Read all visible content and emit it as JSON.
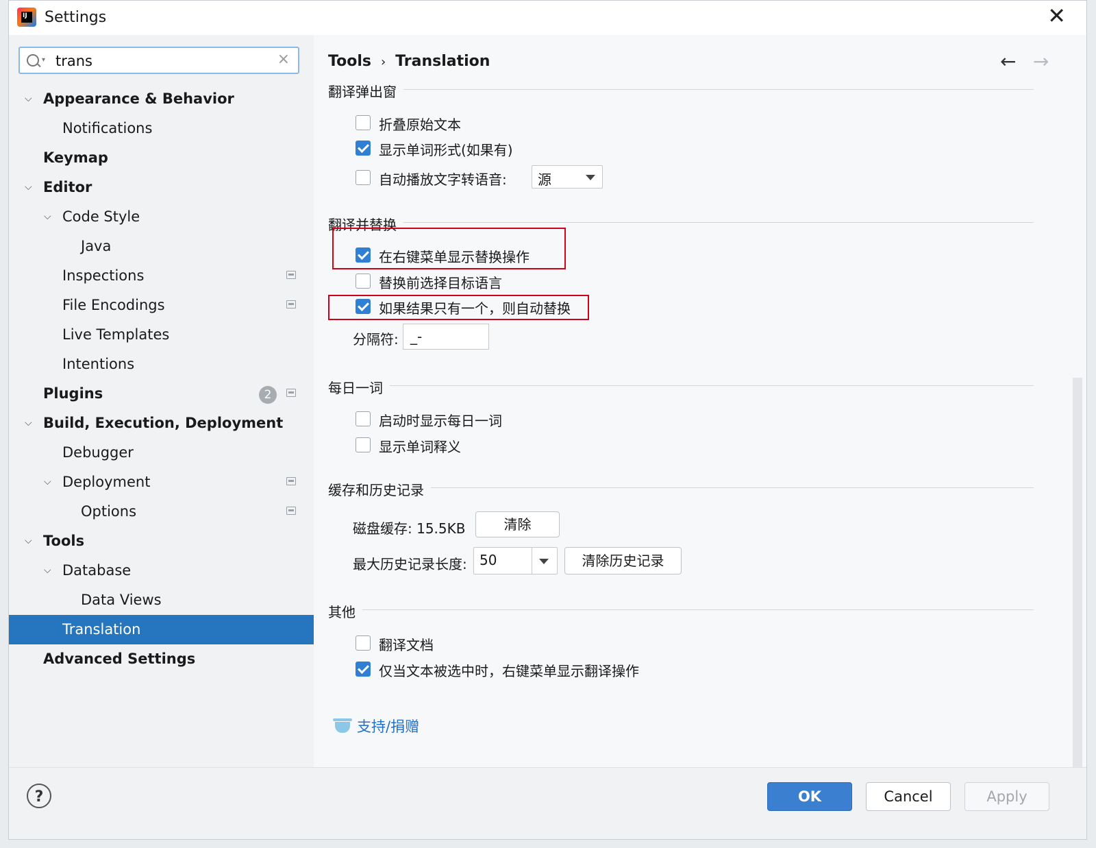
{
  "window": {
    "title": "Settings",
    "close_icon": "close-icon"
  },
  "search": {
    "value": "trans",
    "placeholder": ""
  },
  "sidebar": {
    "items": [
      {
        "label": "Appearance & Behavior",
        "level": 0,
        "bold": true,
        "expanded": true
      },
      {
        "label": "Notifications",
        "level": 1
      },
      {
        "label": "Keymap",
        "level": 0,
        "bold": true
      },
      {
        "label": "Editor",
        "level": 0,
        "bold": true,
        "expanded": true
      },
      {
        "label": "Code Style",
        "level": 1,
        "expanded": true
      },
      {
        "label": "Java",
        "level": 2
      },
      {
        "label": "Inspections",
        "level": 1,
        "project_icon": true
      },
      {
        "label": "File Encodings",
        "level": 1,
        "project_icon": true
      },
      {
        "label": "Live Templates",
        "level": 1
      },
      {
        "label": "Intentions",
        "level": 1
      },
      {
        "label": "Plugins",
        "level": 0,
        "bold": true,
        "badge": "2",
        "project_icon": true
      },
      {
        "label": "Build, Execution, Deployment",
        "level": 0,
        "bold": true,
        "expanded": true
      },
      {
        "label": "Debugger",
        "level": 1
      },
      {
        "label": "Deployment",
        "level": 1,
        "expanded": true,
        "project_icon": true
      },
      {
        "label": "Options",
        "level": 2,
        "project_icon": true
      },
      {
        "label": "Tools",
        "level": 0,
        "bold": true,
        "expanded": true
      },
      {
        "label": "Database",
        "level": 1,
        "expanded": true
      },
      {
        "label": "Data Views",
        "level": 2
      },
      {
        "label": "Translation",
        "level": 1,
        "selected": true
      },
      {
        "label": "Advanced Settings",
        "level": 0,
        "bold": true
      }
    ]
  },
  "breadcrumb": {
    "parent": "Tools",
    "separator": "›",
    "current": "Translation"
  },
  "sections": {
    "popup": {
      "title": "翻译弹出窗",
      "fold_original": {
        "label": "折叠原始文本",
        "checked": false
      },
      "show_word_forms": {
        "label": "显示单词形式(如果有)",
        "checked": true
      },
      "auto_tts": {
        "label": "自动播放文字转语音:",
        "checked": false,
        "select_value": "源"
      }
    },
    "replace": {
      "title": "翻译并替换",
      "show_in_context_menu": {
        "label": "在右键菜单显示替换操作",
        "checked": true
      },
      "select_target_lang": {
        "label": "替换前选择目标语言",
        "checked": false
      },
      "auto_replace_single": {
        "label": "如果结果只有一个，则自动替换",
        "checked": true
      },
      "separator_label": "分隔符:",
      "separator_value": "_-"
    },
    "word_of_day": {
      "title": "每日一词",
      "show_on_startup": {
        "label": "启动时显示每日一词",
        "checked": false
      },
      "show_explanation": {
        "label": "显示单词释义",
        "checked": false
      }
    },
    "cache": {
      "title": "缓存和历史记录",
      "disk_cache_label": "磁盘缓存: 15.5KB",
      "clear_button": "清除",
      "max_history_label": "最大历史记录长度:",
      "max_history_value": "50",
      "clear_history_button": "清除历史记录"
    },
    "other": {
      "title": "其他",
      "translate_docs": {
        "label": "翻译文档",
        "checked": false
      },
      "only_when_selected": {
        "label": "仅当文本被选中时，右键菜单显示翻译操作",
        "checked": true
      }
    },
    "support_link": "支持/捐赠"
  },
  "footer": {
    "help": "?",
    "ok": "OK",
    "cancel": "Cancel",
    "apply": "Apply"
  },
  "colors": {
    "accent": "#2675bf",
    "ok_button": "#3a7fd0",
    "highlight_box": "#d0021b"
  }
}
